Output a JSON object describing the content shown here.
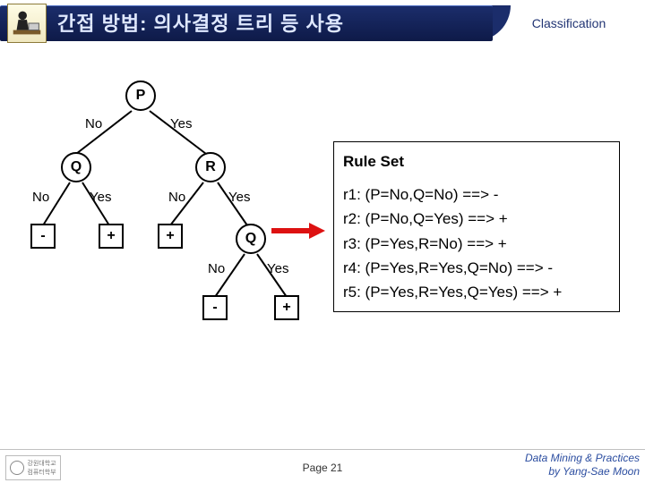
{
  "header": {
    "title": "간접 방법: 의사결정 트리 등 사용",
    "section": "Classification"
  },
  "tree": {
    "root": "P",
    "root_no": "No",
    "root_yes": "Yes",
    "left": "Q",
    "left_no": "No",
    "left_yes": "Yes",
    "right": "R",
    "right_no": "No",
    "right_yes": "Yes",
    "rq": "Q",
    "rq_no": "No",
    "rq_yes": "Yes",
    "leaf_minus": "-",
    "leaf_plus": "+"
  },
  "rules": {
    "title": "Rule Set",
    "r1": "r1: (P=No,Q=No) ==> -",
    "r2": "r2: (P=No,Q=Yes) ==> +",
    "r3": "r3: (P=Yes,R=No) ==> +",
    "r4": "r4: (P=Yes,R=Yes,Q=No) ==> -",
    "r5": "r5: (P=Yes,R=Yes,Q=Yes) ==> +"
  },
  "footer": {
    "page": "Page 21",
    "credit_line1": "Data Mining & Practices",
    "credit_line2": "by Yang-Sae Moon"
  }
}
